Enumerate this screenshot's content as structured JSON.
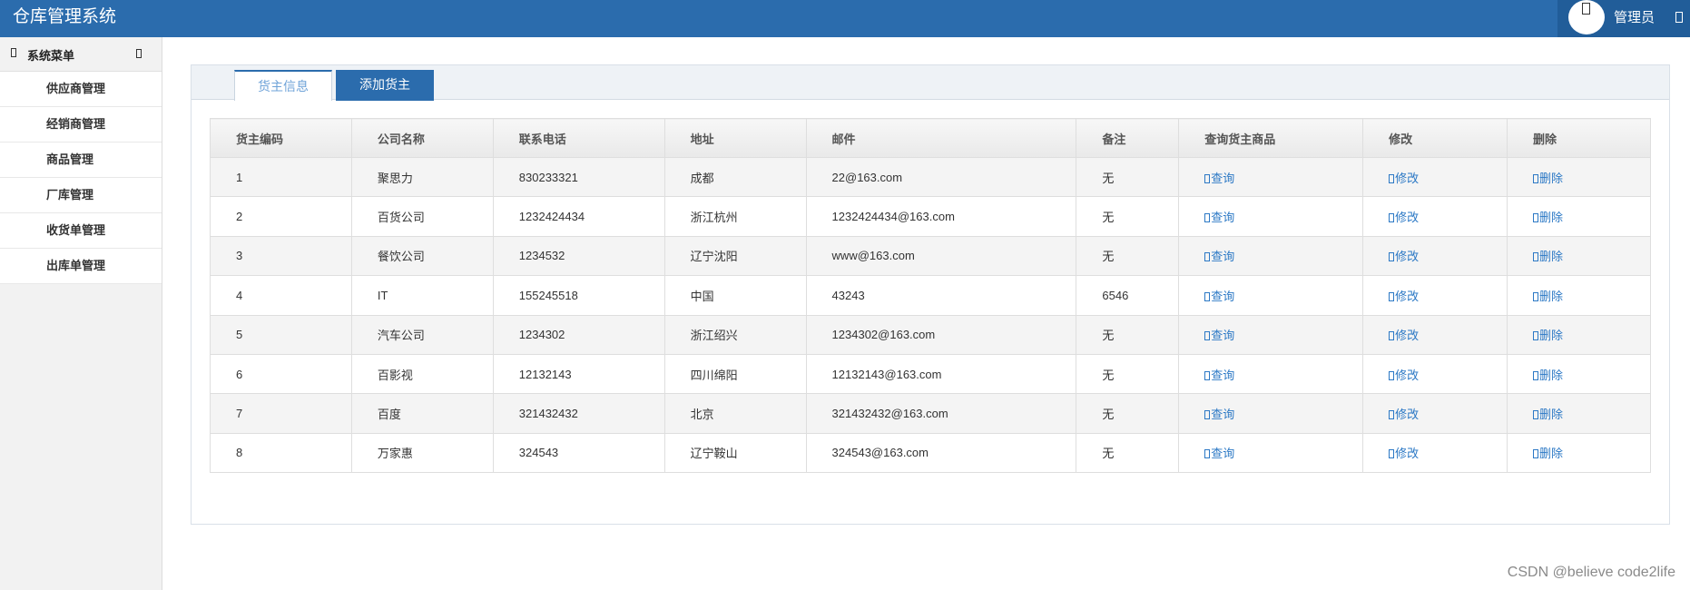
{
  "app": {
    "title": "仓库管理系统"
  },
  "user": {
    "name": "管理员"
  },
  "sidebar": {
    "header": "系统菜单",
    "items": [
      "供应商管理",
      "经销商管理",
      "商品管理",
      "厂库管理",
      "收货单管理",
      "出库单管理"
    ]
  },
  "tabs": {
    "active": "货主信息",
    "add": "添加货主"
  },
  "table": {
    "headers": [
      "货主编码",
      "公司名称",
      "联系电话",
      "地址",
      "邮件",
      "备注",
      "查询货主商品",
      "修改",
      "删除"
    ],
    "actions": {
      "query": "查询",
      "edit": "修改",
      "delete": "删除"
    },
    "rows": [
      {
        "code": "1",
        "company": "聚思力",
        "phone": "830233321",
        "address": "成都",
        "email": "22@163.com",
        "note": "无"
      },
      {
        "code": "2",
        "company": "百货公司",
        "phone": "1232424434",
        "address": "浙江杭州",
        "email": "1232424434@163.com",
        "note": "无"
      },
      {
        "code": "3",
        "company": "餐饮公司",
        "phone": "1234532",
        "address": "辽宁沈阳",
        "email": "www@163.com",
        "note": "无"
      },
      {
        "code": "4",
        "company": "IT",
        "phone": "155245518",
        "address": "中国",
        "email": "43243",
        "note": "6546"
      },
      {
        "code": "5",
        "company": "汽车公司",
        "phone": "1234302",
        "address": "浙江绍兴",
        "email": "1234302@163.com",
        "note": "无"
      },
      {
        "code": "6",
        "company": "百影视",
        "phone": "12132143",
        "address": "四川绵阳",
        "email": "12132143@163.com",
        "note": "无"
      },
      {
        "code": "7",
        "company": "百度",
        "phone": "321432432",
        "address": "北京",
        "email": "321432432@163.com",
        "note": "无"
      },
      {
        "code": "8",
        "company": "万家惠",
        "phone": "324543",
        "address": "辽宁鞍山",
        "email": "324543@163.com",
        "note": "无"
      }
    ]
  },
  "watermark": "CSDN @believe code2life",
  "colors": {
    "header": "#2b6cad",
    "link": "#2b78c5"
  }
}
